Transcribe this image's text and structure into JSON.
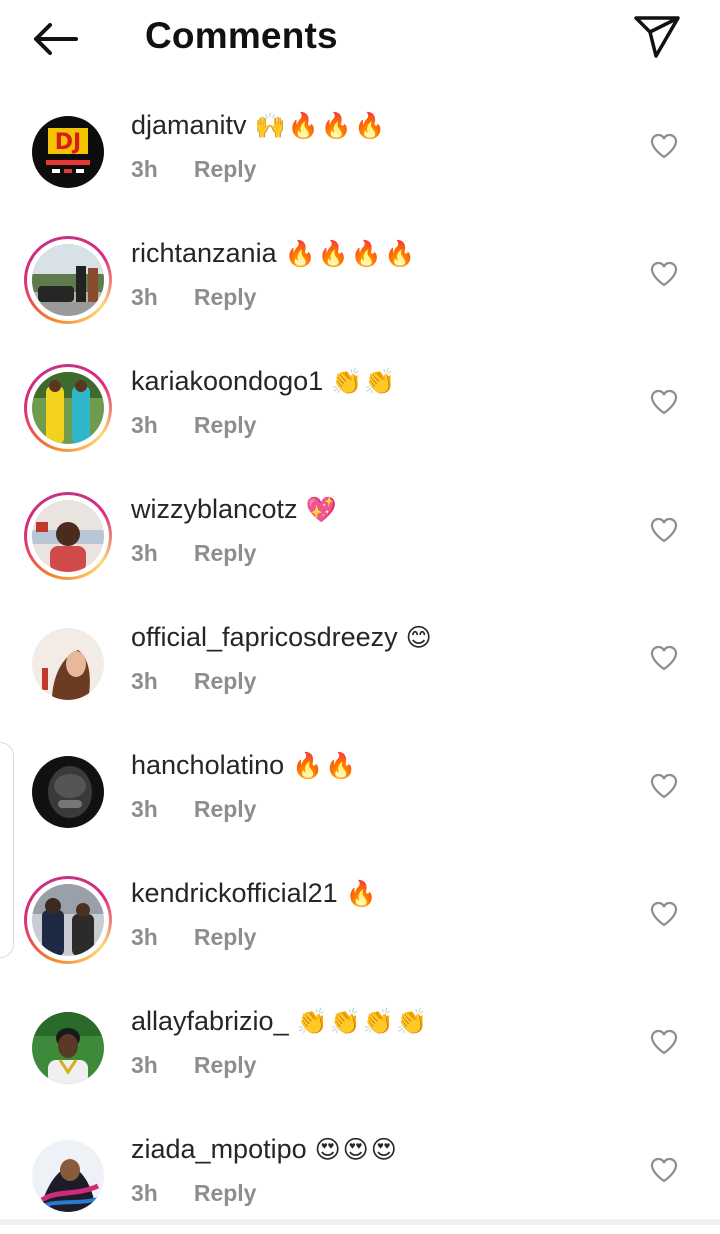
{
  "header": {
    "title": "Comments",
    "back_icon": "arrow-left-icon",
    "share_icon": "paper-plane-icon"
  },
  "colors": {
    "text": "#262626",
    "meta": "#8e8e8e",
    "story_ring": [
      "#f58529",
      "#dd2a7b",
      "#feda75"
    ]
  },
  "comments": [
    {
      "username": "djamanitv",
      "emojis": "🙌🔥🔥🔥",
      "time": "3h",
      "reply_label": "Reply",
      "story_ring": false,
      "avatar_icon": "dj-logo-avatar"
    },
    {
      "username": "richtanzania",
      "emojis": "🔥🔥🔥🔥",
      "time": "3h",
      "reply_label": "Reply",
      "story_ring": true,
      "avatar_icon": "photo-avatar"
    },
    {
      "username": "kariakoondogo1",
      "emojis": "👏👏",
      "time": "3h",
      "reply_label": "Reply",
      "story_ring": true,
      "avatar_icon": "photo-avatar"
    },
    {
      "username": "wizzyblancotz",
      "emojis": "💖",
      "time": "3h",
      "reply_label": "Reply",
      "story_ring": true,
      "avatar_icon": "photo-avatar"
    },
    {
      "username": "official_fapricosdreezy",
      "emojis": "😊",
      "time": "3h",
      "reply_label": "Reply",
      "story_ring": false,
      "avatar_icon": "photo-avatar"
    },
    {
      "username": "hancholatino",
      "emojis": "🔥🔥",
      "time": "3h",
      "reply_label": "Reply",
      "story_ring": false,
      "avatar_icon": "photo-avatar"
    },
    {
      "username": "kendrickofficial21",
      "emojis": "🔥",
      "time": "3h",
      "reply_label": "Reply",
      "story_ring": true,
      "avatar_icon": "photo-avatar"
    },
    {
      "username": "allayfabrizio_",
      "emojis": "👏👏👏👏",
      "time": "3h",
      "reply_label": "Reply",
      "story_ring": false,
      "avatar_icon": "photo-avatar"
    },
    {
      "username": "ziada_mpotipo",
      "emojis": "😍😍😍",
      "time": "3h",
      "reply_label": "Reply",
      "story_ring": false,
      "avatar_icon": "photo-avatar"
    }
  ]
}
